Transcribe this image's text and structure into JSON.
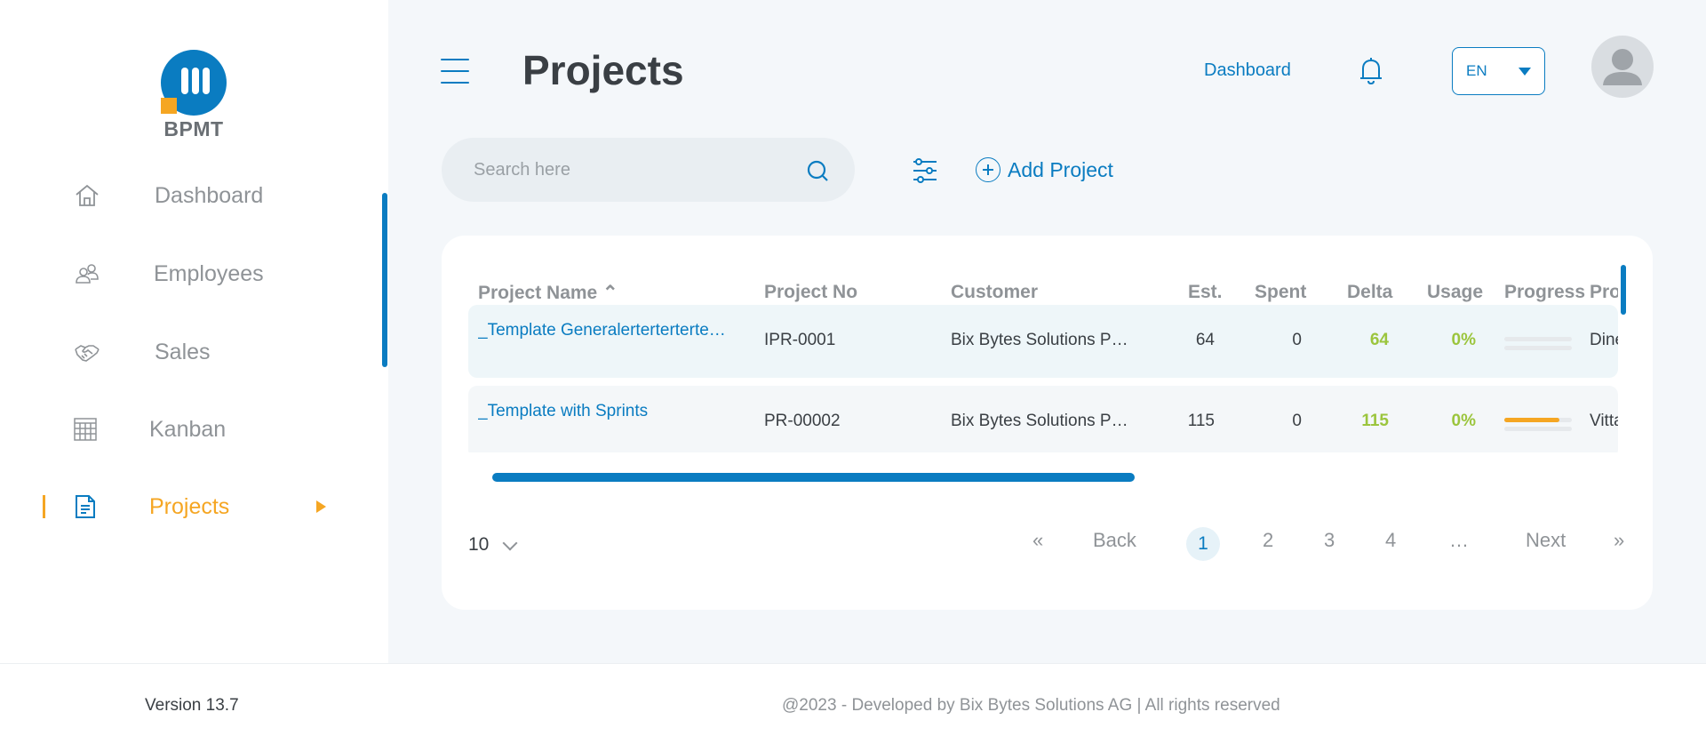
{
  "app": {
    "logo_text": "BPMT",
    "version": "Version 13.7",
    "copyright": "@2023  -  Developed by Bix Bytes Solutions AG  |  All rights reserved"
  },
  "sidebar": {
    "items": [
      {
        "label": "Dashboard",
        "icon": "home-icon",
        "active": false
      },
      {
        "label": "Employees",
        "icon": "users-icon",
        "active": false
      },
      {
        "label": "Sales",
        "icon": "handshake-icon",
        "active": false
      },
      {
        "label": "Kanban",
        "icon": "kanban-icon",
        "active": false
      },
      {
        "label": "Projects",
        "icon": "document-icon",
        "active": true
      }
    ]
  },
  "header": {
    "title": "Projects",
    "dashboard_link": "Dashboard",
    "language": "EN"
  },
  "toolbar": {
    "search_placeholder": "Search here",
    "add_project_label": "Add Project"
  },
  "table": {
    "columns": [
      "Project Name ⌃",
      "Project No",
      "Customer",
      "Est.",
      "Spent",
      "Delta",
      "Usage",
      "Progress",
      "Pro"
    ],
    "rows": [
      {
        "name": "_Template Generalerterterterte…",
        "number": "IPR-0001",
        "customer": "Bix Bytes Solutions P…",
        "est": "64",
        "spent": "0",
        "delta": "64",
        "usage": "0%",
        "progress": 0.0,
        "extra": "Dine"
      },
      {
        "name": "_Template with Sprints",
        "number": "PR-00002",
        "customer": "Bix Bytes Solutions P…",
        "est": "115",
        "spent": "0",
        "delta": "115",
        "usage": "0%",
        "progress": 0.82,
        "extra": "Vitta"
      }
    ]
  },
  "pagination": {
    "page_size": "10",
    "first": "«",
    "back": "Back",
    "pages": [
      "1",
      "2",
      "3",
      "4",
      "…"
    ],
    "next": "Next",
    "last": "»",
    "current": "1"
  },
  "colors": {
    "accent": "#0a7cc1",
    "active": "#f5a623",
    "positive": "#9bc53d"
  }
}
